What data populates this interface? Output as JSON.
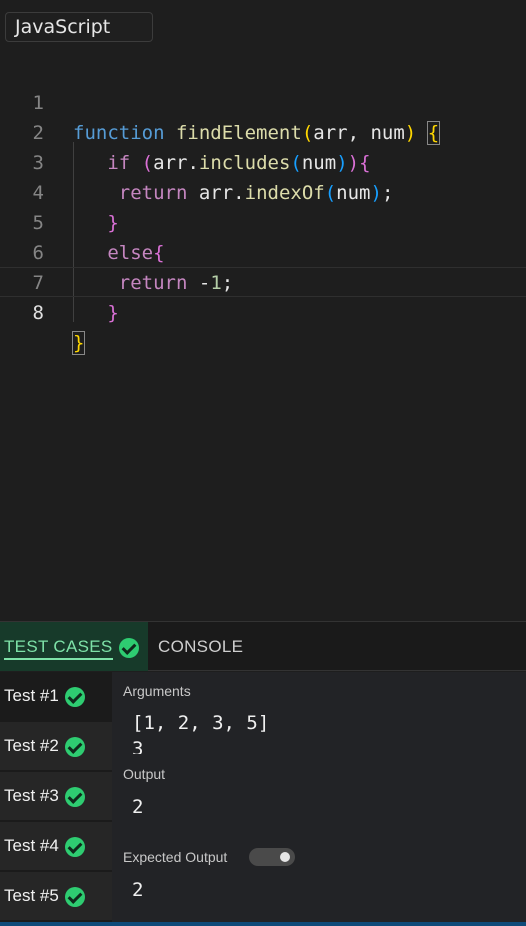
{
  "language_select": {
    "value": "JavaScript"
  },
  "editor": {
    "line_numbers": [
      "1",
      "2",
      "3",
      "4",
      "5",
      "6",
      "7",
      "8"
    ],
    "active_line": "8"
  },
  "tabs": {
    "test_cases": "TEST CASES",
    "console": "CONSOLE"
  },
  "tests": [
    {
      "label": "Test #1",
      "passed": true
    },
    {
      "label": "Test #2",
      "passed": true
    },
    {
      "label": "Test #3",
      "passed": true
    },
    {
      "label": "Test #4",
      "passed": true
    },
    {
      "label": "Test #5",
      "passed": true
    }
  ],
  "details": {
    "arguments_label": "Arguments",
    "arguments_value": "[1, 2, 3, 5]",
    "arguments_value_2": "3",
    "output_label": "Output",
    "output_value": "2",
    "expected_label": "Expected Output",
    "expected_value": "2"
  },
  "colors": {
    "keyword": "#569cd6",
    "control": "#c586c0",
    "function": "#dcdcaa",
    "pass": "#2ecc71",
    "active_tab_bg": "#173a2a"
  },
  "icons": [
    "check-circle-icon"
  ]
}
